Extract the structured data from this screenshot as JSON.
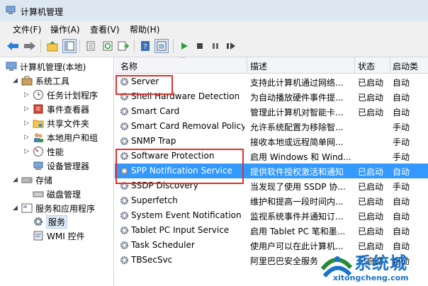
{
  "window": {
    "title": "计算机管理"
  },
  "menu": [
    "文件(F)",
    "操作(A)",
    "查看(V)",
    "帮助(H)"
  ],
  "toolbar": {
    "icons": [
      "back-icon",
      "forward-icon",
      "up-icon",
      "show-tree-icon",
      "export-icon",
      "refresh-icon",
      "export-list-icon",
      "help-icon",
      "properties-icon",
      "play-icon",
      "stop-icon",
      "pause-icon",
      "restart-icon"
    ],
    "accent": "#3399ff"
  },
  "tree": {
    "root": "计算机管理(本地)",
    "items": [
      "系统工具",
      "任务计划程序",
      "事件查看器",
      "共享文件夹",
      "本地用户和组",
      "性能",
      "设备管理器",
      "存储",
      "磁盘管理",
      "服务和应用程序",
      "服务",
      "WMI 控件"
    ]
  },
  "list": {
    "columns": [
      "名称",
      "描述",
      "状态",
      "启动类"
    ],
    "rows": [
      {
        "name": "Server",
        "desc": "支持此计算机通过网络...",
        "state": "已启动",
        "start": "自动"
      },
      {
        "name": "Shell Hardware Detection",
        "desc": "为自动播放硬件事件提...",
        "state": "已启动",
        "start": "自动"
      },
      {
        "name": "Smart Card",
        "desc": "管理此计算机对智能卡...",
        "state": "已启动",
        "start": "自动"
      },
      {
        "name": "Smart Card Removal Policy",
        "desc": "允许系统配置为移除智...",
        "state": "",
        "start": "手动"
      },
      {
        "name": "SNMP Trap",
        "desc": "接收本地或远程简单网...",
        "state": "",
        "start": "手动"
      },
      {
        "name": "Software Protection",
        "desc": "启用 Windows 和 Wind...",
        "state": "",
        "start": "手动"
      },
      {
        "name": "SPP Notification Service",
        "desc": "提供软件授权激活和通知",
        "state": "已启动",
        "start": "自动"
      },
      {
        "name": "SSDP Discovery",
        "desc": "当发现了使用 SSDP 协...",
        "state": "已启动",
        "start": "手动"
      },
      {
        "name": "Superfetch",
        "desc": "维护和提高一段时间内...",
        "state": "已启动",
        "start": "自动"
      },
      {
        "name": "System Event Notification ...",
        "desc": "监视系统事件并通知订...",
        "state": "已启动",
        "start": "自动"
      },
      {
        "name": "Tablet PC Input Service",
        "desc": "启用 Tablet PC 笔和墨...",
        "state": "已启动",
        "start": "自动"
      },
      {
        "name": "Task Scheduler",
        "desc": "使用户可以在此计算机...",
        "state": "已启动",
        "start": "自动"
      },
      {
        "name": "TBSecSvc",
        "desc": "阿里巴巴安全服务",
        "state": "已启动",
        "start": "自动"
      }
    ]
  },
  "watermark": {
    "brand": "系统城",
    "url": "xitongcheng.com"
  }
}
